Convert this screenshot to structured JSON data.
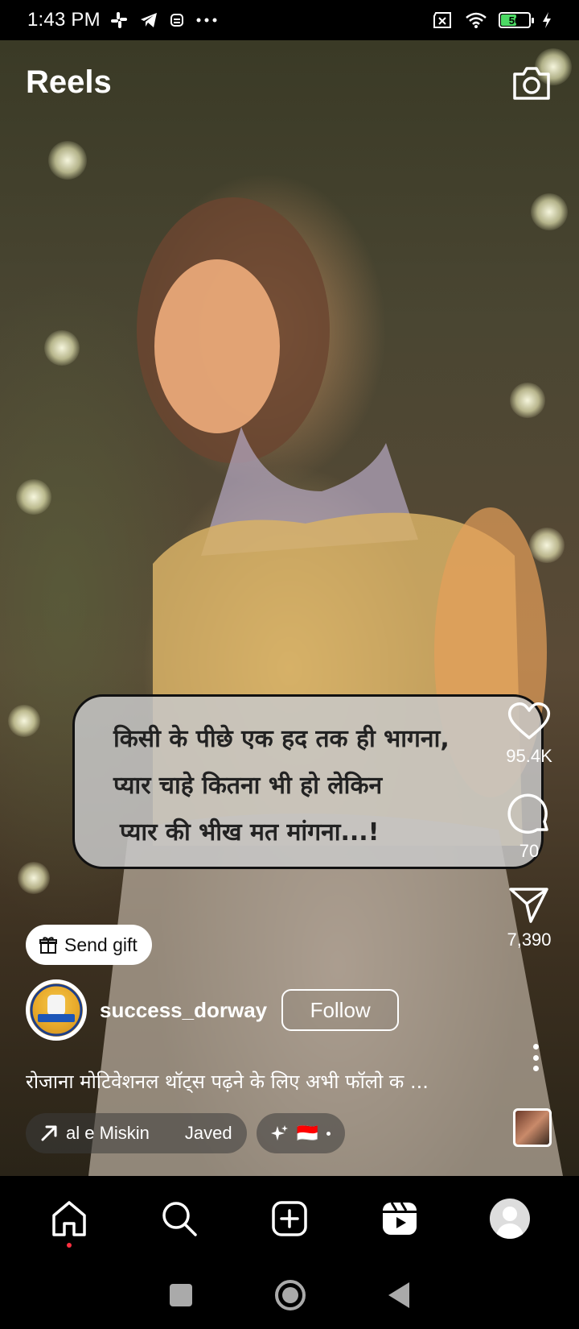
{
  "status_bar": {
    "time": "1:43 PM",
    "battery_level": "56",
    "icons": [
      "slack-icon",
      "telegram-icon",
      "bot-icon",
      "more-dots-icon",
      "sim-off-icon",
      "wifi-icon",
      "battery-icon",
      "charging-icon"
    ]
  },
  "header": {
    "title": "Reels",
    "camera_icon": "camera-icon"
  },
  "overlay_text": {
    "line1": "किसी के पीछे एक हद तक ही भागना,",
    "line2": "प्यार चाहे कितना भी हो लेकिन",
    "line3": "प्यार की भीख मत मांगना...!"
  },
  "actions": {
    "likes": "95.4K",
    "comments": "70",
    "shares": "7,390"
  },
  "send_gift": {
    "label": "Send gift"
  },
  "profile": {
    "username": "success_dorway",
    "follow_label": "Follow"
  },
  "caption": {
    "text": "रोजाना मोटिवेशनल थॉट्स पढ़ने के लिए अभी फॉलो क ..."
  },
  "chips": {
    "audio_name": "al e Miskin",
    "audio_artist": "Javed",
    "effects_flag": "🇮🇩"
  },
  "bottom_nav": {
    "items": [
      "home-icon",
      "search-icon",
      "create-icon",
      "reels-icon",
      "profile-avatar"
    ]
  },
  "colors": {
    "accent": "#ff3040",
    "battery": "#4cd964"
  }
}
